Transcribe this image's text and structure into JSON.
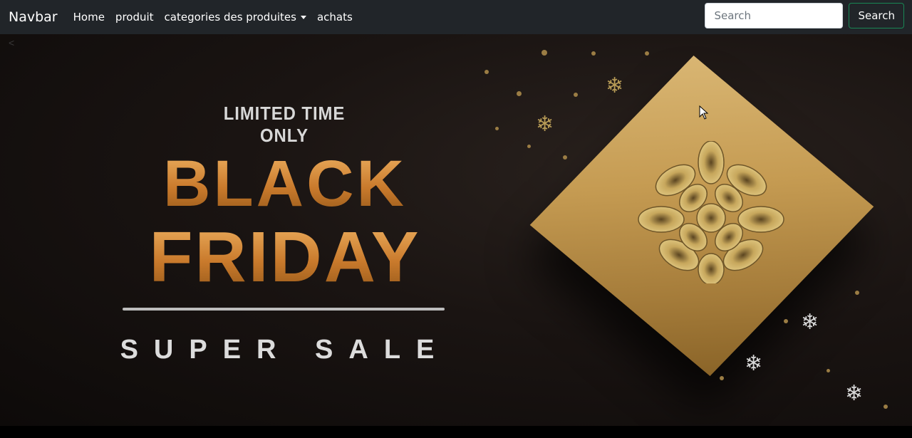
{
  "navbar": {
    "brand": "Navbar",
    "links": [
      {
        "label": "Home"
      },
      {
        "label": "produit"
      },
      {
        "label": "categories des produites"
      },
      {
        "label": "achats"
      }
    ],
    "search": {
      "placeholder": "Search",
      "button_label": "Search"
    }
  },
  "carousel": {
    "prev_label": "<",
    "banner": {
      "tagline": "LIMITED TIME ONLY",
      "headline_line1": "BLACK",
      "headline_line2": "FRIDAY",
      "subline": "SUPER SALE"
    }
  },
  "colors": {
    "navbar_bg": "#212529",
    "search_button_border": "#198754",
    "headline_gold": "#d9943f",
    "gift_gold": "#c59b52"
  }
}
